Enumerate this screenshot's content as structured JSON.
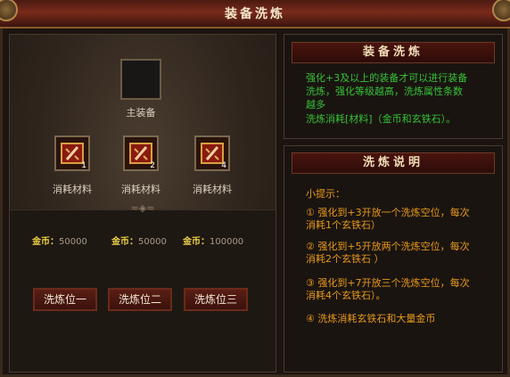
{
  "window": {
    "title": "装备洗炼"
  },
  "left": {
    "main_slot_label": "主装备",
    "materials": [
      {
        "label": "消耗材料",
        "count": "1",
        "icon": "book-icon"
      },
      {
        "label": "消耗材料",
        "count": "2",
        "icon": "book-icon"
      },
      {
        "label": "消耗材料",
        "count": "4",
        "icon": "book-icon"
      }
    ],
    "gold": [
      {
        "key": "金币：",
        "value": "50000"
      },
      {
        "key": "金币：",
        "value": "50000"
      },
      {
        "key": "金币：",
        "value": "100000"
      }
    ],
    "buttons": [
      "洗炼位一",
      "洗炼位二",
      "洗炼位三"
    ]
  },
  "info": {
    "header": "装备洗炼",
    "lines": [
      "强化+3及以上的装备才可以进行装备",
      "洗炼，强化等级越高，洗炼属性条数",
      "越多"
    ],
    "cost": "洗炼消耗[材料]（金币和玄铁石）。"
  },
  "explain": {
    "header": "洗炼说明",
    "tip_title": "小提示：",
    "tips": [
      [
        "① 强化到+3开放一个洗炼空位，每次",
        "消耗1个玄铁石）"
      ],
      [
        "② 强化到+5开放两个洗炼空位，每次",
        "消耗2个玄铁石 ）"
      ],
      [
        "③ 强化到+7开放三个洗炼空位，每次",
        "消耗4个玄铁石）。"
      ],
      [
        "④ 洗炼消耗玄铁石和大量金币"
      ]
    ]
  },
  "colors": {
    "green_text": "#36c236",
    "orange_text": "#e89a1a",
    "gold_label": "#f0d34a"
  }
}
